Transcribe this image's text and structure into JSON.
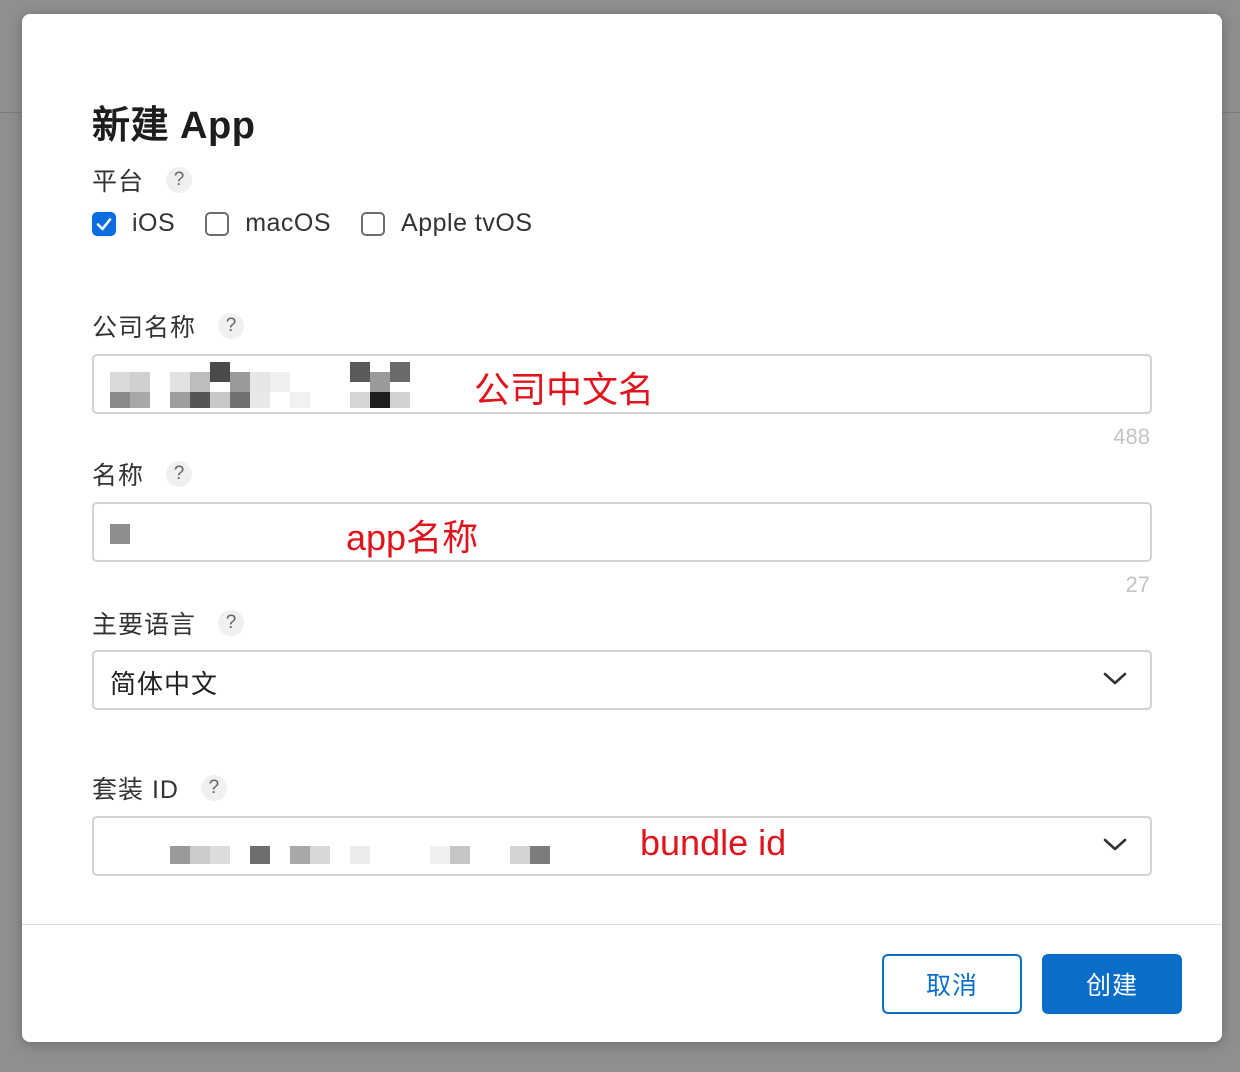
{
  "dialog": {
    "title": "新建 App"
  },
  "platform": {
    "label": "平台",
    "help": "?",
    "options": [
      {
        "label": "iOS",
        "checked": true
      },
      {
        "label": "macOS",
        "checked": false
      },
      {
        "label": "Apple tvOS",
        "checked": false
      }
    ]
  },
  "company": {
    "label": "公司名称",
    "help": "?",
    "annotation": "公司中文名",
    "counter": "488"
  },
  "name": {
    "label": "名称",
    "help": "?",
    "annotation": "app名称",
    "counter": "27"
  },
  "language": {
    "label": "主要语言",
    "help": "?",
    "selected": "简体中文"
  },
  "bundle": {
    "label": "套装 ID",
    "help": "?",
    "annotation": "bundle id"
  },
  "footer": {
    "cancel_label": "取消",
    "create_label": "创建"
  },
  "colors": {
    "accent": "#0a6ec8",
    "annotation": "#e0141c"
  }
}
